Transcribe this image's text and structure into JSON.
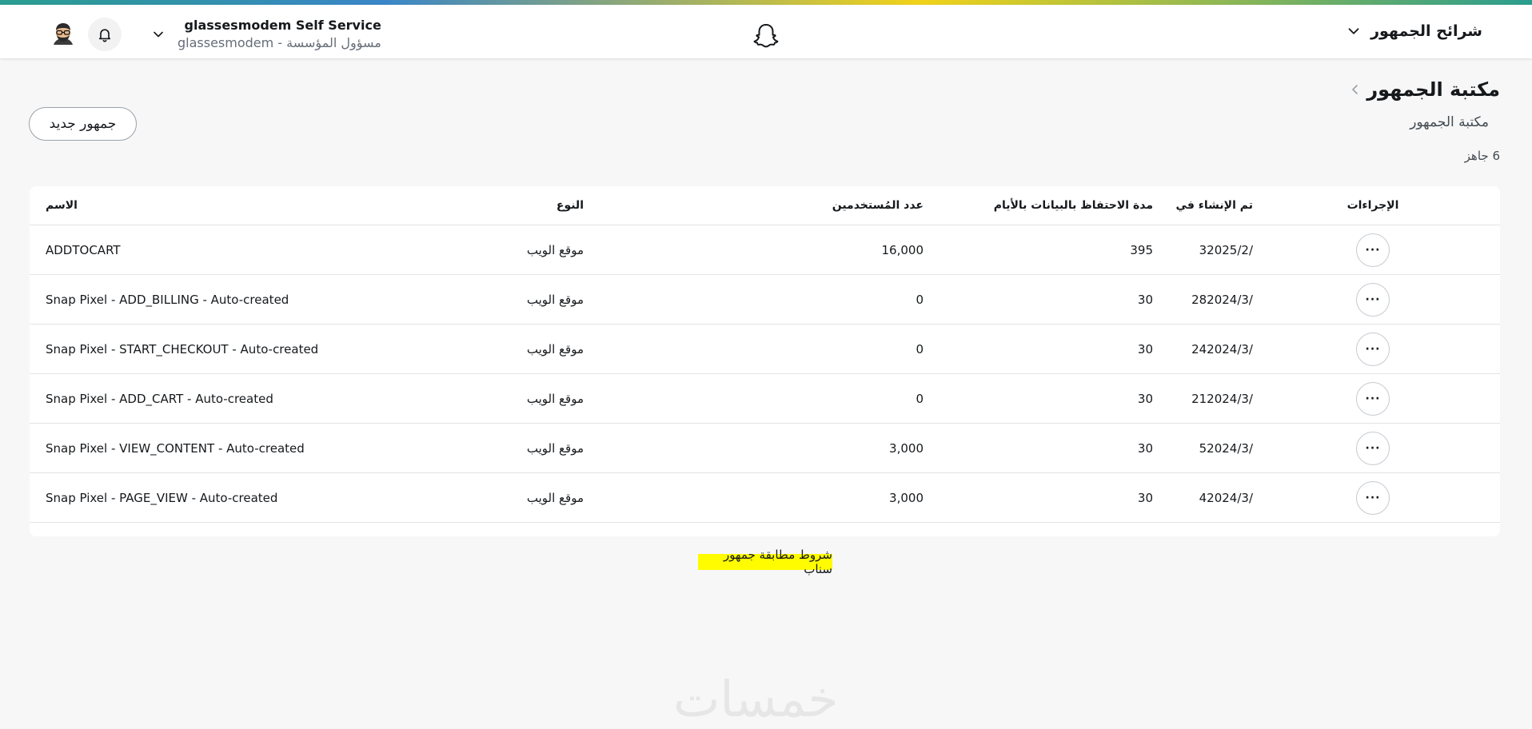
{
  "header": {
    "section_label": "شرائح الجمهور",
    "account_name": "glassesmodem Self Service",
    "account_sub": "glassesmodem - مسؤول المؤسسة"
  },
  "page": {
    "title": "مكتبة الجمهور",
    "tab_label": "مكتبة الجمهور",
    "count": "6 جاهز",
    "new_button": "جمهور جديد"
  },
  "table": {
    "headers": {
      "name": "الاسم",
      "type": "النوع",
      "users": "عدد المُستخدمين",
      "retention": "مدة الاحتفاظ بالبيانات بالأيام",
      "created": "تم الإنشاء في",
      "actions": "الإجراءات"
    },
    "rows": [
      {
        "name": "ADDTOCART",
        "type": "موقع الويب",
        "users": "16,000",
        "retention": "395",
        "created": "32025/2/"
      },
      {
        "name": "Snap Pixel - ADD_BILLING - Auto-created",
        "type": "موقع الويب",
        "users": "0",
        "retention": "30",
        "created": "282024/3/"
      },
      {
        "name": "Snap Pixel - START_CHECKOUT - Auto-created",
        "type": "موقع الويب",
        "users": "0",
        "retention": "30",
        "created": "242024/3/"
      },
      {
        "name": "Snap Pixel - ADD_CART - Auto-created",
        "type": "موقع الويب",
        "users": "0",
        "retention": "30",
        "created": "212024/3/"
      },
      {
        "name": "Snap Pixel - VIEW_CONTENT - Auto-created",
        "type": "موقع الويب",
        "users": "3,000",
        "retention": "30",
        "created": "52024/3/"
      },
      {
        "name": "Snap Pixel - PAGE_VIEW - Auto-created",
        "type": "موقع الويب",
        "users": "3,000",
        "retention": "30",
        "created": "42024/3/"
      }
    ],
    "more_label": "···"
  },
  "footer": {
    "terms_link": "شروط مطابقة جمهور سناب",
    "watermark": "خمسات"
  },
  "colors": {
    "accent_yellow": "#fffc00",
    "background": "#f7f7f7"
  }
}
